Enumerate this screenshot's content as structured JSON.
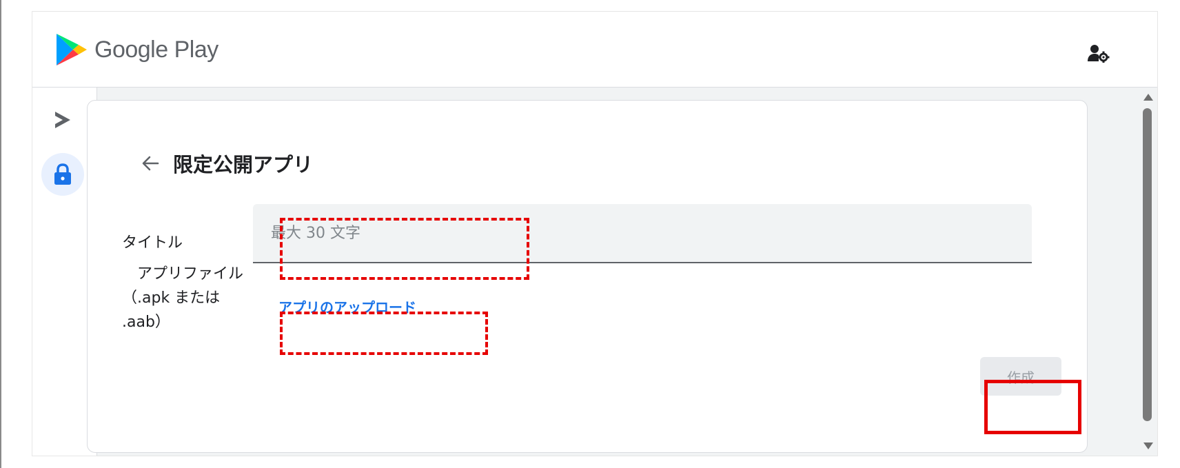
{
  "header": {
    "brand": "Google Play"
  },
  "page": {
    "title": "限定公開アプリ"
  },
  "form": {
    "title_label": "タイトル",
    "title_placeholder": "最大 30 文字",
    "title_value": "",
    "file_label": "　アプリファイル\n（.apk または .aab）",
    "upload_label": "アプリのアップロード",
    "create_label": "作成"
  },
  "icons": {
    "logo": "google-play-logo",
    "account": "account-settings-icon",
    "rail_play": "play-console-icon",
    "rail_private": "lock-icon",
    "back": "arrow-back-icon"
  },
  "colors": {
    "accent": "#1a73e8",
    "highlight": "#e60000",
    "disabled_text": "#9aa0a6",
    "rail_active_bg": "#e8f0fe"
  }
}
